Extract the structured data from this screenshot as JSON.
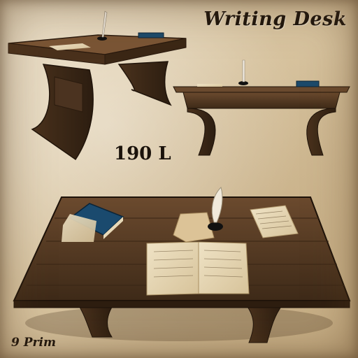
{
  "title": "Writing Desk",
  "price": "190 L",
  "prims": "9 Prim"
}
